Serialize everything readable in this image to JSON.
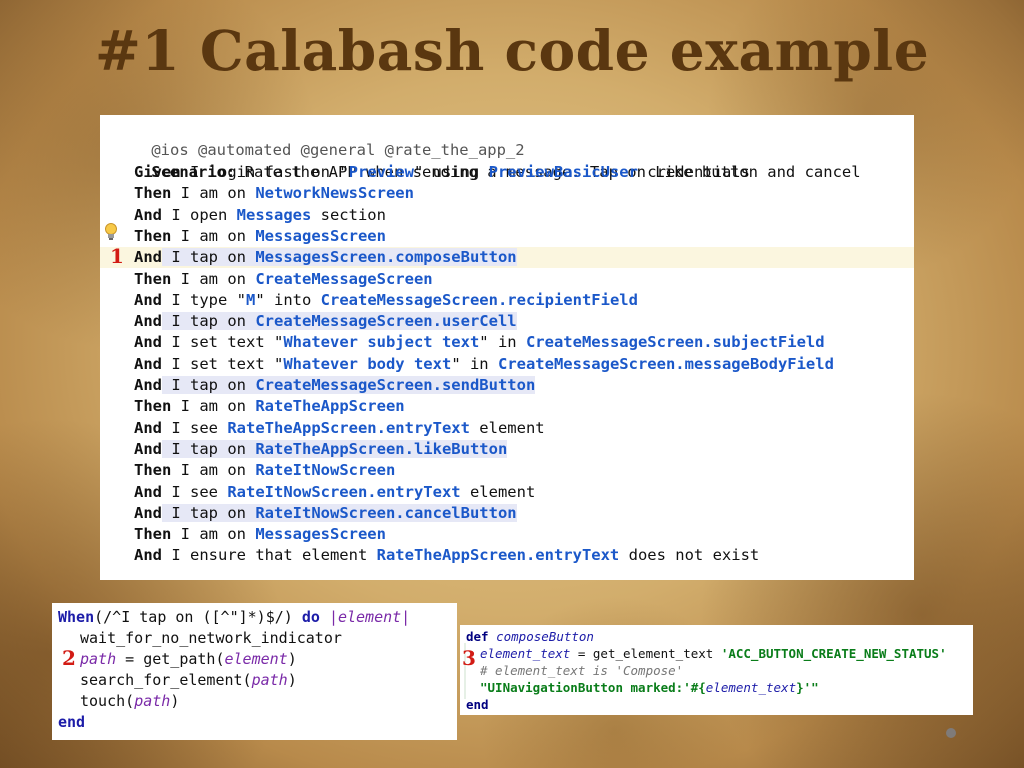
{
  "slide": {
    "title": "#1 Calabash code example",
    "markers": [
      "1",
      "2",
      "3"
    ]
  },
  "feature": {
    "tags": "@ios @automated @general @rate_the_app_2",
    "scenario_kw": "Scenario:",
    "scenario_text": " Rate the APP when sending a message. Tap on Like button and cancel",
    "steps": [
      {
        "kw": "Given",
        "pre": " I login fast on \"",
        "str": "Preview",
        "mid": "\" using ",
        "nav": "PreviewBasicUser",
        "post": " credentials"
      },
      {
        "kw": "Then",
        "pre": " I am on ",
        "nav": "NetworkNewsScreen"
      },
      {
        "kw": "And",
        "pre": " I open ",
        "nav": "Messages",
        "post": " section"
      },
      {
        "kw": "Then",
        "pre": " I am on ",
        "nav": "MessagesScreen"
      },
      {
        "kw": "And",
        "pre": " I tap on ",
        "nav": "MessagesScreen.composeButton"
      },
      {
        "kw": "Then",
        "pre": " I am on ",
        "nav": "CreateMessageScreen"
      },
      {
        "kw": "And",
        "pre": " I type \"",
        "str": "M",
        "mid": "\" into ",
        "nav": "CreateMessageScreen.recipientField"
      },
      {
        "kw": "And",
        "pre": " I tap on ",
        "nav": "CreateMessageScreen.userCell"
      },
      {
        "kw": "And",
        "pre": " I set text \"",
        "str": "Whatever subject text",
        "mid": "\" in ",
        "nav": "CreateMessageScreen.subjectField"
      },
      {
        "kw": "And",
        "pre": " I set text \"",
        "str": "Whatever body text",
        "mid": "\" in ",
        "nav": "CreateMessageScreen.messageBodyField"
      },
      {
        "kw": "And",
        "pre": " I tap on ",
        "nav": "CreateMessageScreen.sendButton"
      },
      {
        "kw": "Then",
        "pre": " I am on ",
        "nav": "RateTheAppScreen"
      },
      {
        "kw": "And",
        "pre": " I see ",
        "nav": "RateTheAppScreen.entryText",
        "post": " element"
      },
      {
        "kw": "And",
        "pre": " I tap on ",
        "nav": "RateTheAppScreen.likeButton"
      },
      {
        "kw": "Then",
        "pre": " I am on ",
        "nav": "RateItNowScreen"
      },
      {
        "kw": "And",
        "pre": " I see ",
        "nav": "RateItNowScreen.entryText",
        "post": " element"
      },
      {
        "kw": "And",
        "pre": " I tap on ",
        "nav": "RateItNowScreen.cancelButton"
      },
      {
        "kw": "Then",
        "pre": " I am on ",
        "nav": "MessagesScreen"
      },
      {
        "kw": "And",
        "pre": " I ensure that element ",
        "nav": "RateTheAppScreen.entryText",
        "post": " does not exist"
      }
    ]
  },
  "step_def": {
    "when": "When",
    "regex": "(/^I tap on ([^\"]*)$/)",
    "do": "do",
    "param": "|element|",
    "line2": "wait_for_no_network_indicator",
    "l3_var": "path",
    "l3_eq": " = get_path(",
    "l3_arg": "element",
    "l3_end": ")",
    "l4_pre": "search_for_element(",
    "l4_arg": "path",
    "l4_end": ")",
    "l5_pre": "touch(",
    "l5_arg": "path",
    "l5_end": ")",
    "end": "end"
  },
  "screen_def": {
    "def": "def",
    "method": "composeButton",
    "l2_var": "element_text",
    "l2_eq": " = get_element_text ",
    "l2_str": "'ACC_BUTTON_CREATE_NEW_STATUS'",
    "l3_comment": "# element_text is 'Compose'",
    "l4_str_a": "\"UINavigationButton marked:'#{",
    "l4_var": "element_text",
    "l4_str_b": "}'\"",
    "end": "end"
  }
}
